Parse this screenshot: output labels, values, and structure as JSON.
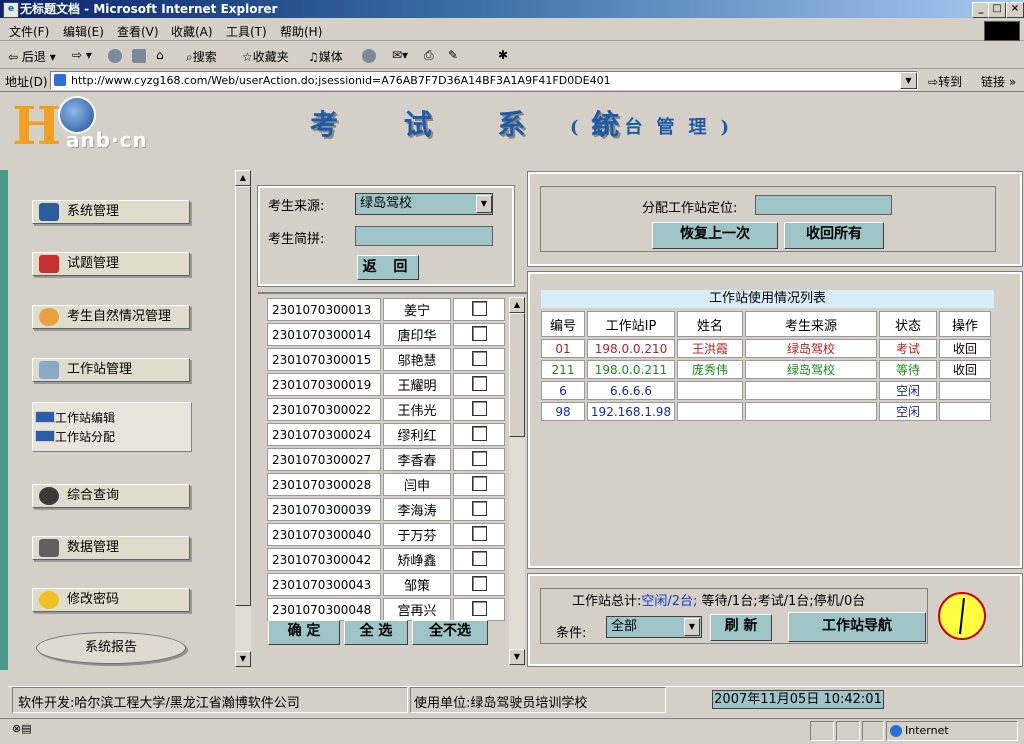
{
  "window": {
    "title": "无标题文档 - Microsoft Internet Explorer"
  },
  "menubar": [
    "文件(F)",
    "编辑(E)",
    "查看(V)",
    "收藏(A)",
    "工具(T)",
    "帮助(H)"
  ],
  "toolbar": {
    "back": "后退",
    "search": "搜索",
    "favorites": "收藏夹",
    "media": "媒体"
  },
  "address": {
    "label": "地址(D)",
    "url": "http://www.cyzg168.com/Web/userAction.do;jsessionid=A76AB7F7D36A14BF3A1A9F41FD0DE401",
    "goto": "转到",
    "links": "链接"
  },
  "header": {
    "logo_h": "H",
    "logo_text": "anb·cn",
    "title": "考 试 系 统",
    "subtitle": "(后台管理)"
  },
  "nav": {
    "items": [
      "系统管理",
      "试题管理",
      "考生自然情况管理",
      "工作站管理",
      "综合查询",
      "数据管理",
      "修改密码"
    ],
    "sub_items": [
      "工作站编辑",
      "工作站分配"
    ],
    "report": "系统报告"
  },
  "search": {
    "source_label": "考生来源:",
    "source_value": "绿岛驾校",
    "abbr_label": "考生简拼:",
    "back_button": "返 回"
  },
  "students": [
    {
      "id": "2301070300013",
      "name": "姜宁"
    },
    {
      "id": "2301070300014",
      "name": "唐印华"
    },
    {
      "id": "2301070300015",
      "name": "邬艳慧"
    },
    {
      "id": "2301070300019",
      "name": "王耀明"
    },
    {
      "id": "2301070300022",
      "name": "王伟光"
    },
    {
      "id": "2301070300024",
      "name": "缪利红"
    },
    {
      "id": "2301070300027",
      "name": "李香春"
    },
    {
      "id": "2301070300028",
      "name": "闫申"
    },
    {
      "id": "2301070300039",
      "name": "李海涛"
    },
    {
      "id": "2301070300040",
      "name": "于万芬"
    },
    {
      "id": "2301070300042",
      "name": "矫峥鑫"
    },
    {
      "id": "2301070300043",
      "name": "邹策"
    },
    {
      "id": "2301070300048",
      "name": "宫再兴"
    }
  ],
  "list_buttons": {
    "confirm": "确 定",
    "select_all": "全 选",
    "select_none": "全不选"
  },
  "assign": {
    "label": "分配工作站定位:",
    "restore": "恢复上一次",
    "recall_all": "收回所有"
  },
  "ws_list": {
    "caption": "工作站使用情况列表",
    "headers": [
      "编号",
      "工作站IP",
      "姓名",
      "考生来源",
      "状态",
      "操作"
    ],
    "rows": [
      {
        "no": "01",
        "ip": "198.0.0.210",
        "name": "王洪霞",
        "source": "绿岛驾校",
        "status": "考试",
        "op": "收回",
        "color": "#b02020"
      },
      {
        "no": "211",
        "ip": "198.0.0.211",
        "name": "庞秀伟",
        "source": "绿岛驾校",
        "status": "等待",
        "op": "收回",
        "color": "#1a8a1a"
      },
      {
        "no": "6",
        "ip": "6.6.6.6",
        "name": "",
        "source": "",
        "status": "空闲",
        "op": "",
        "color": "#1a2a9a"
      },
      {
        "no": "98",
        "ip": "192.168.1.98",
        "name": "",
        "source": "",
        "status": "空闲",
        "op": "",
        "color": "#1a2a9a"
      }
    ]
  },
  "summary": {
    "prefix": "工作站总计:",
    "idle": "空闲/2台;",
    "rest": " 等待/1台;考试/1台;停机/0台"
  },
  "filter": {
    "label": "条件:",
    "value": "全部",
    "refresh": "刷 新",
    "nav": "工作站导航"
  },
  "footer": {
    "dev": "软件开发:哈尔滨工程大学/黑龙江省瀚博软件公司",
    "user": "使用单位:绿岛驾驶员培训学校",
    "datetime": "2007年11月05日  10:42:01"
  },
  "statusbar": {
    "zone": "Internet"
  }
}
